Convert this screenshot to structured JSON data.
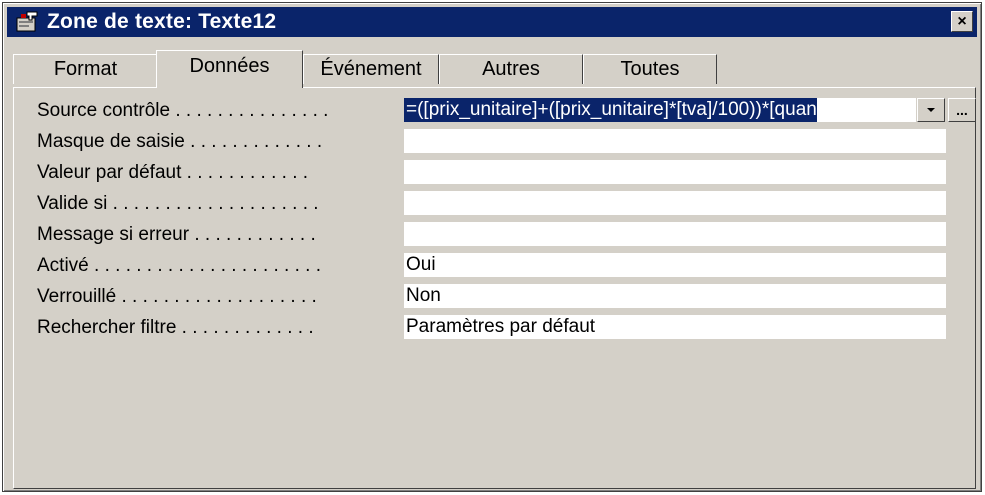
{
  "window": {
    "title": "Zone de texte: Texte12",
    "close_label": "×",
    "icon": "properties-icon"
  },
  "tabs": [
    {
      "label": "Format",
      "active": false
    },
    {
      "label": "Données",
      "active": true
    },
    {
      "label": "Événement",
      "active": false
    },
    {
      "label": "Autres",
      "active": false
    },
    {
      "label": "Toutes",
      "active": false
    }
  ],
  "properties": [
    {
      "label": "Source contrôle . . . . . . . . . . . . . . .",
      "value": "=([prix_unitaire]+([prix_unitaire]*[tva]/100))*[quan",
      "selected": true
    },
    {
      "label": "Masque de saisie . . . . . . . . . . . . .",
      "value": ""
    },
    {
      "label": "Valeur par défaut . . . . . . . . . . . .",
      "value": ""
    },
    {
      "label": "Valide si . . . . . . . . . . . . . . . . . . . .",
      "value": ""
    },
    {
      "label": "Message si erreur . . . . . . . . . . . .",
      "value": ""
    },
    {
      "label": "Activé . . . . . . . . . . . . . . . . . . . . . .",
      "value": "Oui"
    },
    {
      "label": "Verrouillé . . . . . . . . . . . . . . . . . . .",
      "value": "Non"
    },
    {
      "label": "Rechercher filtre . . . . . . . . . . . . .",
      "value": "Paramètres par défaut"
    }
  ],
  "buttons": {
    "dropdown_icon": "chevron-down-icon",
    "builder_label": "..."
  },
  "colors": {
    "titlebar": "#0a246a",
    "face": "#d4d0c8",
    "selection": "#0a246a"
  }
}
